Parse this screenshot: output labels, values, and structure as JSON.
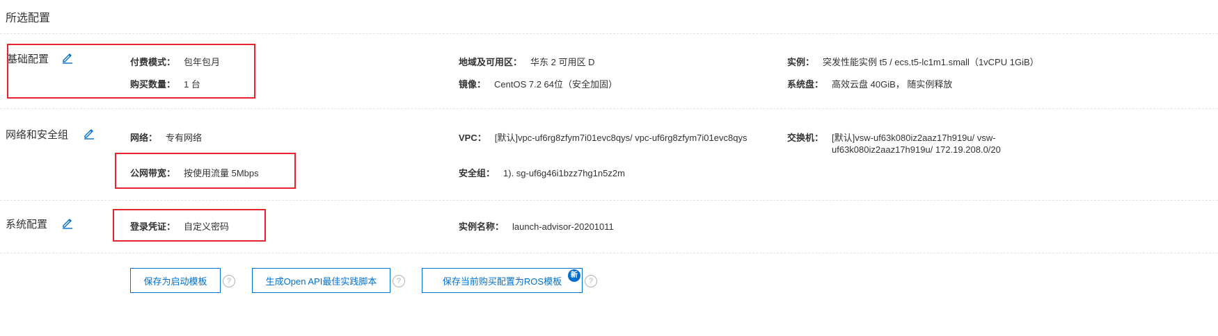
{
  "page_title": "所选配置",
  "colors": {
    "link": "#0070cc",
    "highlight_box": "#e8232d",
    "divider": "#e3e3e3"
  },
  "sections": {
    "basic": {
      "title": "基础配置",
      "fields": {
        "pay_mode": {
          "label": "付费模式：",
          "value": "包年包月"
        },
        "quantity": {
          "label": "购买数量：",
          "value": "1 台"
        },
        "region": {
          "label": "地域及可用区：",
          "value": "华东 2 可用区 D"
        },
        "image": {
          "label": "镜像：",
          "value": "CentOS 7.2 64位（安全加固）"
        },
        "instance": {
          "label": "实例：",
          "value": "突发性能实例 t5 / ecs.t5-lc1m1.small（1vCPU 1GiB）"
        },
        "system_disk": {
          "label": "系统盘：",
          "value": "高效云盘 40GiB， 随实例释放"
        }
      }
    },
    "network": {
      "title": "网络和安全组",
      "fields": {
        "network": {
          "label": "网络：",
          "value": "专有网络"
        },
        "bandwidth": {
          "label": "公网带宽：",
          "value": "按使用流量 5Mbps"
        },
        "vpc": {
          "label": "VPC：",
          "value": "[默认]vpc-uf6rg8zfym7i01evc8qys/ vpc-uf6rg8zfym7i01evc8qys"
        },
        "security_group": {
          "label": "安全组：",
          "value": "1). sg-uf6g46i1bzz7hg1n5z2m"
        },
        "vswitch": {
          "label": "交换机：",
          "value_line1": "[默认]vsw-uf63k080iz2aaz17h919u/ vsw-",
          "value_line2": "uf63k080iz2aaz17h919u/ 172.19.208.0/20"
        }
      }
    },
    "system": {
      "title": "系统配置",
      "fields": {
        "credential": {
          "label": "登录凭证：",
          "value": "自定义密码"
        },
        "instance_name": {
          "label": "实例名称：",
          "value": "launch-advisor-20201011"
        }
      }
    }
  },
  "actions": {
    "save_template": "保存为启动模板",
    "generate_api": "生成Open API最佳实践脚本",
    "save_ros": "保存当前购买配置为ROS模板",
    "new_badge": "新",
    "help_glyph": "?"
  },
  "icons": {
    "edit": "pencil-edit-icon",
    "help": "question-circle-icon"
  }
}
